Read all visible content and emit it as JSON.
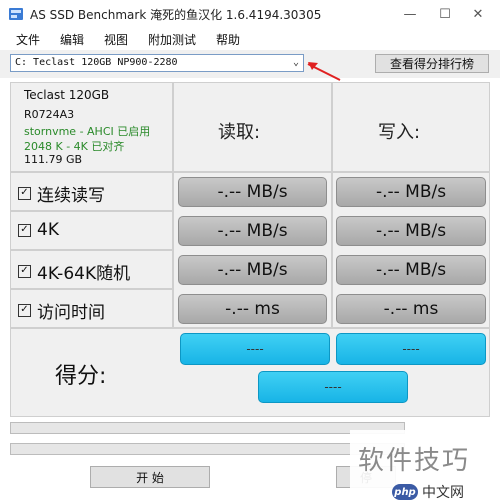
{
  "window": {
    "title": "AS SSD Benchmark 淹死的鱼汉化 1.6.4194.30305",
    "min_glyph": "—",
    "max_glyph": "☐",
    "close_glyph": "✕"
  },
  "menu": [
    "文件",
    "编辑",
    "视图",
    "附加测试",
    "帮助"
  ],
  "drive_select": {
    "value": "C: Teclast 120GB NP900-2280",
    "arrow": "⌄"
  },
  "rank_button": "查看得分排行榜",
  "drive_info": {
    "name": "Teclast 120GB",
    "firmware": "R0724A3",
    "driver": "stornvme - AHCI 已启用",
    "alignment": "2048 K - 4K 已对齐",
    "capacity": "111.79 GB",
    "status_color": "#2a8a2a"
  },
  "columns": {
    "read": "读取:",
    "write": "写入:"
  },
  "tests": [
    {
      "label": "连续读写",
      "read": "-.-- MB/s",
      "write": "-.-- MB/s",
      "checked": true
    },
    {
      "label": "4K",
      "read": "-.-- MB/s",
      "write": "-.-- MB/s",
      "checked": true
    },
    {
      "label": "4K-64K随机",
      "read": "-.-- MB/s",
      "write": "-.-- MB/s",
      "checked": true
    },
    {
      "label": "访问时间",
      "read": "-.-- ms",
      "write": "-.-- ms",
      "checked": true
    }
  ],
  "score": {
    "label": "得分:",
    "read": "----",
    "write": "----",
    "total": "----",
    "color": "#18b4e6"
  },
  "buttons": {
    "start": "开 始",
    "abort": "停"
  },
  "watermark": {
    "text": "软件技巧",
    "brand_badge": "php",
    "brand_text": "中文网"
  }
}
